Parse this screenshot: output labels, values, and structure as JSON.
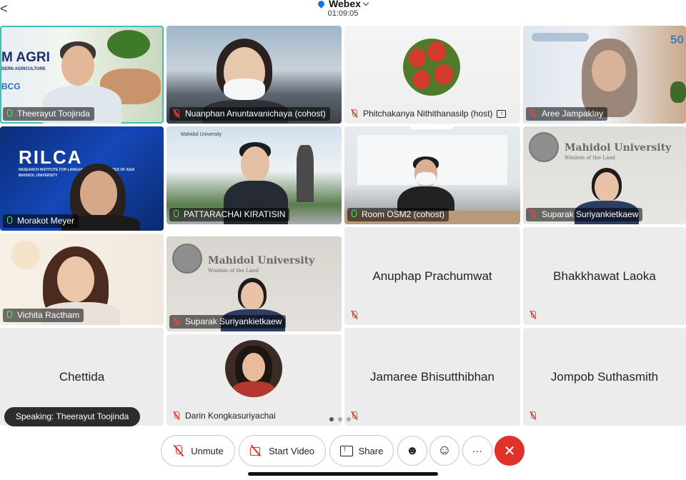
{
  "header": {
    "back_glyph": "<",
    "app_title": "Webex",
    "timer": "01:09:05"
  },
  "participants": [
    {
      "name": "Theerayut Toojinda",
      "mic": "on",
      "active_speaker": true,
      "logo_text": "M AGRI",
      "logo_sub": "DERN AGRICULTURE",
      "logo_badge": "BCG"
    },
    {
      "name": "Nuanphan Anuntavanichaya (cohost)",
      "mic": "off"
    },
    {
      "name": "Phitchakanya Nithithanasilp (host)",
      "mic": "off",
      "sharing": true
    },
    {
      "name": "Aree Jampaklay",
      "mic": "off",
      "corner_text": "50"
    },
    {
      "name": "Morakot Meyer",
      "mic": "on",
      "logo_text": "RILCA",
      "logo_sub": "RESEARCH INSTITUTE FOR LANGUAGES AND CULTURES OF ASIA",
      "logo_sub2": "MAHIDOL UNIVERSITY"
    },
    {
      "name": "PATTARACHAI KIRATISIN",
      "mic": "on",
      "banner_text": "Mahidol University"
    },
    {
      "name": "Room OSM2 (cohost)",
      "mic": "on"
    },
    {
      "name": "Suparak Suriyankietkaew",
      "mic": "off",
      "wall_text": "Mahidol University",
      "wall_sub": "Wisdom of the Land"
    },
    {
      "name": "Vichita Ractham",
      "mic": "on"
    },
    {
      "name": "Suparak Suriyankietkaew",
      "mic": "off",
      "wall_text": "Mahidol University",
      "wall_sub": "Wisdom of the Land"
    },
    {
      "name": "Anuphap Prachumwat",
      "mic": "off",
      "video": false
    },
    {
      "name": "Bhakkhawat Laoka",
      "mic": "off",
      "video": false
    },
    {
      "name": "Chettida",
      "mic": "off",
      "video": false
    },
    {
      "name": "Darin Kongkasuriyachai",
      "mic": "off",
      "avatar": true
    },
    {
      "name": "Jamaree Bhisutthibhan",
      "mic": "off",
      "video": false
    },
    {
      "name": "Jompob Suthasmith",
      "mic": "off",
      "video": false
    }
  ],
  "speaking_label": "Speaking: Theerayut Toojinda",
  "pager": {
    "pages": 3,
    "current": 1
  },
  "controls": {
    "unmute": "Unmute",
    "start_video": "Start Video",
    "share": "Share",
    "more": "···",
    "end": "✕"
  },
  "colors": {
    "active_border": "#3fc0b4",
    "end_call": "#e0312b",
    "mic_muted": "#e2483d"
  }
}
